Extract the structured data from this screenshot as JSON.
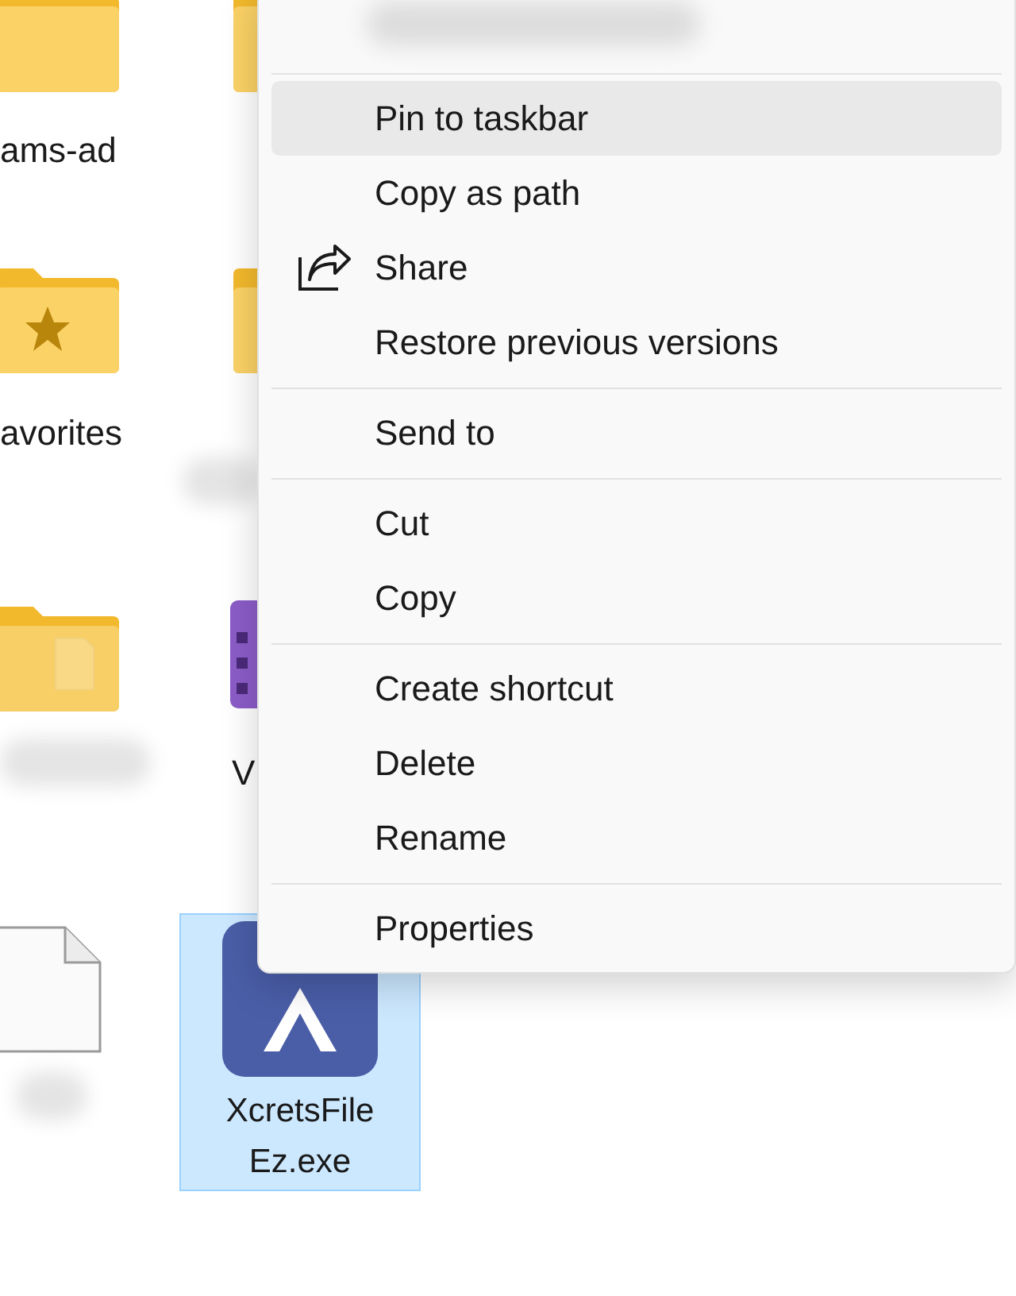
{
  "desktop_items": [
    {
      "kind": "folder",
      "label": "ams-ad",
      "selected": false
    },
    {
      "kind": "star-folder",
      "label": "avorites",
      "selected": false
    },
    {
      "kind": "document-folder",
      "selected": false
    },
    {
      "kind": "blank-file",
      "selected": false
    },
    {
      "kind": "folder",
      "selected": false
    },
    {
      "kind": "folder",
      "selected": false
    },
    {
      "kind": "purple-app",
      "label": "V",
      "selected": false
    },
    {
      "kind": "blue-app",
      "label": "XcretsFileEz.exe",
      "selected": true
    }
  ],
  "context_menu": {
    "groups": [
      [
        {
          "label": "Pin to taskbar",
          "selected": true,
          "has_icon": false
        },
        {
          "label": "Copy as path",
          "selected": false,
          "has_icon": false
        },
        {
          "label": "Share",
          "selected": false,
          "has_icon": true
        },
        {
          "label": "Restore previous versions",
          "selected": false,
          "has_icon": false
        }
      ],
      [
        {
          "label": "Send to",
          "selected": false,
          "has_icon": false
        }
      ],
      [
        {
          "label": "Cut",
          "selected": false,
          "has_icon": false
        },
        {
          "label": "Copy",
          "selected": false,
          "has_icon": false
        }
      ],
      [
        {
          "label": "Create shortcut",
          "selected": false,
          "has_icon": false
        },
        {
          "label": "Delete",
          "selected": false,
          "has_icon": false
        },
        {
          "label": "Rename",
          "selected": false,
          "has_icon": false
        }
      ],
      [
        {
          "label": "Properties",
          "selected": false,
          "has_icon": false
        }
      ]
    ]
  }
}
